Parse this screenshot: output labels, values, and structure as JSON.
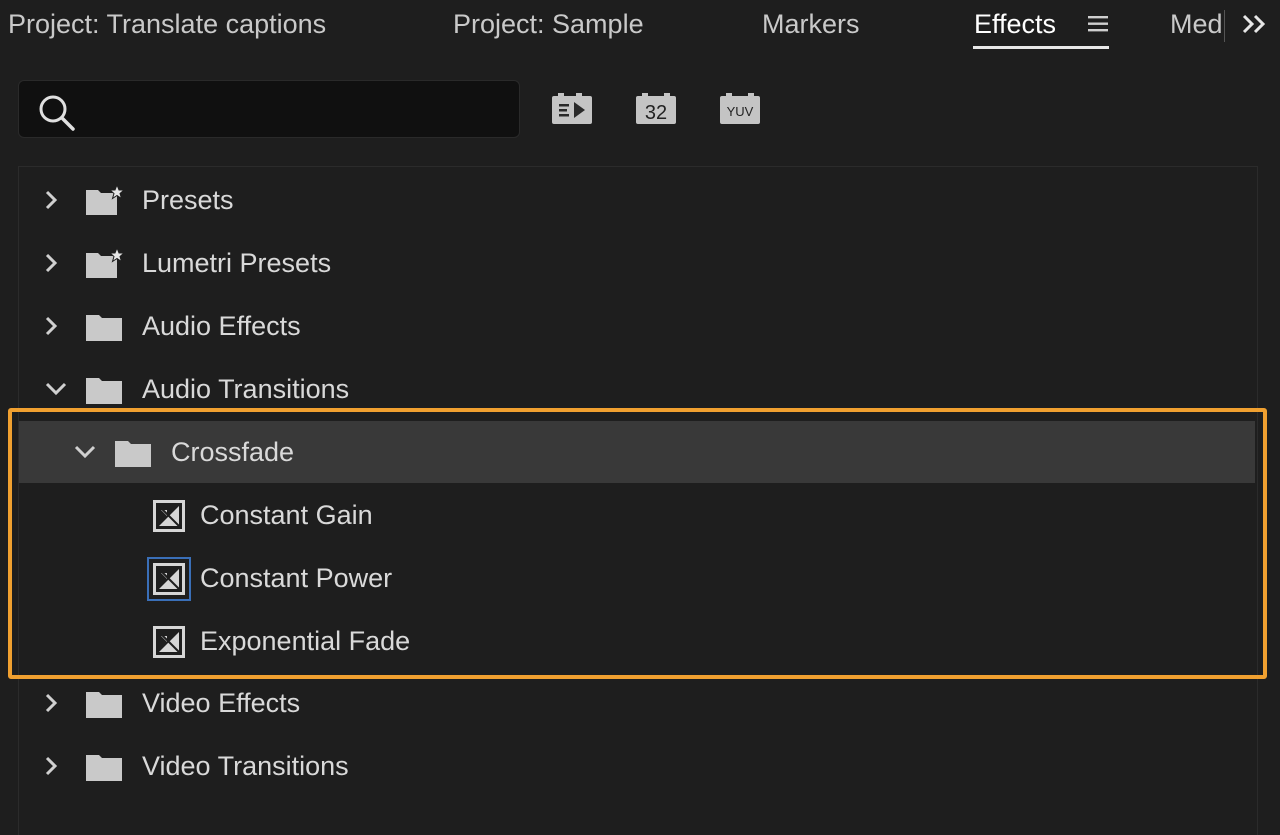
{
  "tabs": [
    {
      "label": "Project: Translate captions",
      "active": false
    },
    {
      "label": "Project: Sample",
      "active": false
    },
    {
      "label": "Markers",
      "active": false
    },
    {
      "label": "Effects",
      "active": true
    },
    {
      "label": "Med",
      "active": false
    }
  ],
  "tab_menu_icon": "hamburger-menu-icon",
  "overflow_icon": "double-chevron-right-icon",
  "search": {
    "value": "",
    "placeholder": "",
    "icon": "search-icon"
  },
  "filter_buttons": [
    {
      "name": "accelerated-effects-icon",
      "text": ""
    },
    {
      "name": "32-bit-color-icon",
      "text": "32"
    },
    {
      "name": "yuv-effects-icon",
      "text": "YUV"
    }
  ],
  "tree": {
    "items": [
      {
        "label": "Presets",
        "type": "preset-folder",
        "expanded": false,
        "level": 0
      },
      {
        "label": "Lumetri Presets",
        "type": "preset-folder",
        "expanded": false,
        "level": 0
      },
      {
        "label": "Audio Effects",
        "type": "folder",
        "expanded": false,
        "level": 0
      },
      {
        "label": "Audio Transitions",
        "type": "folder",
        "expanded": true,
        "level": 0
      },
      {
        "label": "Crossfade",
        "type": "folder",
        "expanded": true,
        "level": 1,
        "selected": true
      },
      {
        "label": "Constant Gain",
        "type": "effect",
        "level": 2
      },
      {
        "label": "Constant Power",
        "type": "effect",
        "level": 2,
        "focused": true
      },
      {
        "label": "Exponential Fade",
        "type": "effect",
        "level": 2
      },
      {
        "label": "Video Effects",
        "type": "folder",
        "expanded": false,
        "level": 0
      },
      {
        "label": "Video Transitions",
        "type": "folder",
        "expanded": false,
        "level": 0
      }
    ]
  },
  "colors": {
    "background": "#1e1e1e",
    "selected_row": "#393939",
    "highlight_frame": "#f0a030",
    "text": "#d9d9d9",
    "active_tab": "#ffffff"
  }
}
